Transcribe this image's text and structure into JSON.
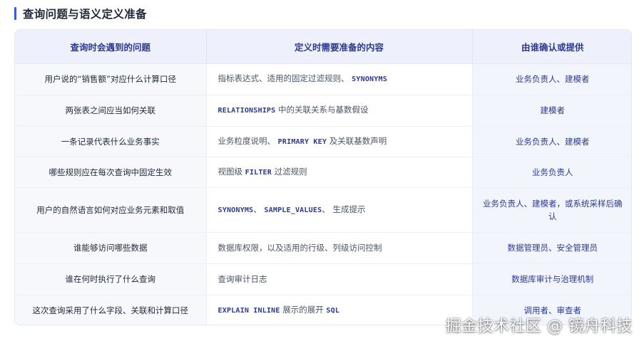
{
  "title": "查询问题与语义定义准备",
  "table": {
    "headers": [
      "查询时会遇到的问题",
      "定义时需要准备的内容",
      "由谁确认或提供"
    ],
    "rows": [
      {
        "question": "用户说的“销售额”对应什么计算口径",
        "prepare": [
          "指标表达式、适用的固定过滤规则、",
          "SYNONYMS",
          ""
        ],
        "owner": "业务负责人、建模者"
      },
      {
        "question": "两张表之间应当如何关联",
        "prepare": [
          "",
          "RELATIONSHIPS",
          " 中的关联关系与基数假设"
        ],
        "owner": "建模者"
      },
      {
        "question": "一条记录代表什么业务事实",
        "prepare": [
          "业务粒度说明、",
          "PRIMARY KEY",
          " 及关联基数声明"
        ],
        "owner": "业务负责人、建模者"
      },
      {
        "question": "哪些规则应在每次查询中固定生效",
        "prepare": [
          "视图级 ",
          "FILTER",
          " 过滤规则"
        ],
        "owner": "业务负责人"
      },
      {
        "question": "用户的自然语言如何对应业务元素和取值",
        "prepare": [
          "",
          "SYNONYMS",
          "、",
          "SAMPLE_VALUES",
          "、 生成提示"
        ],
        "owner": "业务负责人、建模者，或系统采样后确认"
      },
      {
        "question": "谁能够访问哪些数据",
        "prepare": [
          "数据库权限，以及适用的行级、列级访问控制"
        ],
        "owner": "数据管理员、安全管理员"
      },
      {
        "question": "谁在何时执行了什么查询",
        "prepare": [
          "查询审计日志"
        ],
        "owner": "数据库审计与治理机制"
      },
      {
        "question": "这次查询采用了什么字段、关联和计算口径",
        "prepare": [
          "",
          "EXPLAIN INLINE",
          " 展示的展开 ",
          "SQL",
          ""
        ],
        "owner": "调用者、审查者"
      }
    ]
  },
  "watermark": "掘金技术社区 @ 镜舟科技",
  "colors": {
    "accent": "#3b5bdb",
    "header_bg": "#eef1fc",
    "header_text": "#2b3a8f",
    "owner_bg": "#f3f5fd",
    "question_bg": "#f7f8fc"
  }
}
